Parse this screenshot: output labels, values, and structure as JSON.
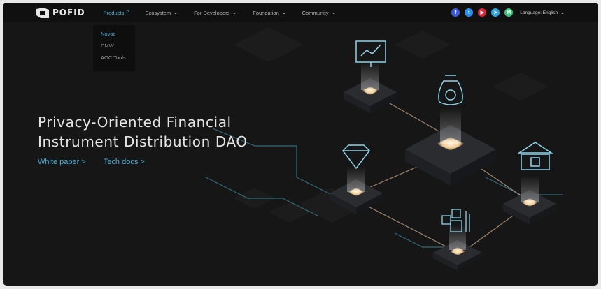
{
  "brand": {
    "name": "POFID"
  },
  "nav": {
    "items": [
      {
        "label": "Products",
        "active": true
      },
      {
        "label": "Ecosystem",
        "active": false
      },
      {
        "label": "For Developers",
        "active": false
      },
      {
        "label": "Foundation",
        "active": false
      },
      {
        "label": "Community",
        "active": false
      }
    ],
    "chevron_up": "^",
    "chevron_down": "⌄"
  },
  "dropdown": {
    "items": [
      {
        "label": "Novac",
        "active": true
      },
      {
        "label": "DMW",
        "active": false
      },
      {
        "label": "AOC Tools",
        "active": false
      }
    ]
  },
  "social": [
    {
      "name": "facebook-icon",
      "glyph": "f",
      "color": "#3b5bdb"
    },
    {
      "name": "twitter-icon",
      "glyph": "t",
      "color": "#2a8ff0"
    },
    {
      "name": "youtube-icon",
      "glyph": "▶",
      "color": "#e0243a"
    },
    {
      "name": "telegram-icon",
      "glyph": "➤",
      "color": "#2aa3e0"
    },
    {
      "name": "medium-icon",
      "glyph": "M",
      "color": "#3bbf7a"
    }
  ],
  "language": {
    "label": "Language: English"
  },
  "hero": {
    "title_line1": "Privacy-Oriented Financial",
    "title_line2": "Instrument Distribution DAO",
    "links": [
      {
        "label": "White paper  >"
      },
      {
        "label": "Tech docs  >"
      }
    ]
  },
  "colors": {
    "accent": "#4aaed8",
    "background": "#161616",
    "platform_glow": "#f4d9b0"
  },
  "chart_data": {
    "type": "table",
    "title": "",
    "nodes": [
      "chart-board",
      "money-bag",
      "central-hub",
      "diamond",
      "bank",
      "cubes"
    ],
    "grid": false
  }
}
